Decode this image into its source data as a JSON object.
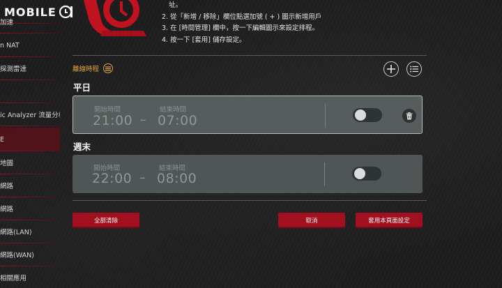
{
  "brand": {
    "logo_text": "MOBILE"
  },
  "sidebar": {
    "items": [
      {
        "label": "",
        "top": 0
      },
      {
        "label": "加速"
      },
      {
        "label": "n NAT"
      },
      {
        "label": "探測雷達"
      },
      {
        "label": ""
      },
      {
        "label": "ic Analyzer 流量分析"
      },
      {
        "label": "E"
      },
      {
        "label": "地圖"
      },
      {
        "label": "網路"
      },
      {
        "label": "網路"
      },
      {
        "label": "網路(LAN)"
      },
      {
        "label": "網路(WAN)"
      },
      {
        "label": "相關應用"
      }
    ]
  },
  "instructions": {
    "line0": "址。",
    "line1": "2. 從「新增 / 移除」欄位點選加號 ( + ) 圖示新增用戶",
    "line2": "3. 在 [時間管理] 欄中，按一下編輯圖示來設定排程。",
    "line3": "4. 按一下 [套用] 儲存設定。"
  },
  "schedule": {
    "title": "離線時程",
    "weekday": {
      "title": "平日",
      "start_label": "開始時間",
      "end_label": "結束時間",
      "start_time": "21:00",
      "end_time": "07:00",
      "separator": "–",
      "enabled": false
    },
    "weekend": {
      "title": "週末",
      "start_label": "開始時間",
      "end_label": "結束時間",
      "start_time": "22:00",
      "end_time": "08:00",
      "separator": "–",
      "enabled": false
    }
  },
  "buttons": {
    "clear_all": "全部清除",
    "cancel": "取消",
    "apply": "套用本頁面設定"
  },
  "colors": {
    "accent_red": "#a2101f",
    "accent_orange": "#e0a43a",
    "card_bg": "#4f5655"
  }
}
